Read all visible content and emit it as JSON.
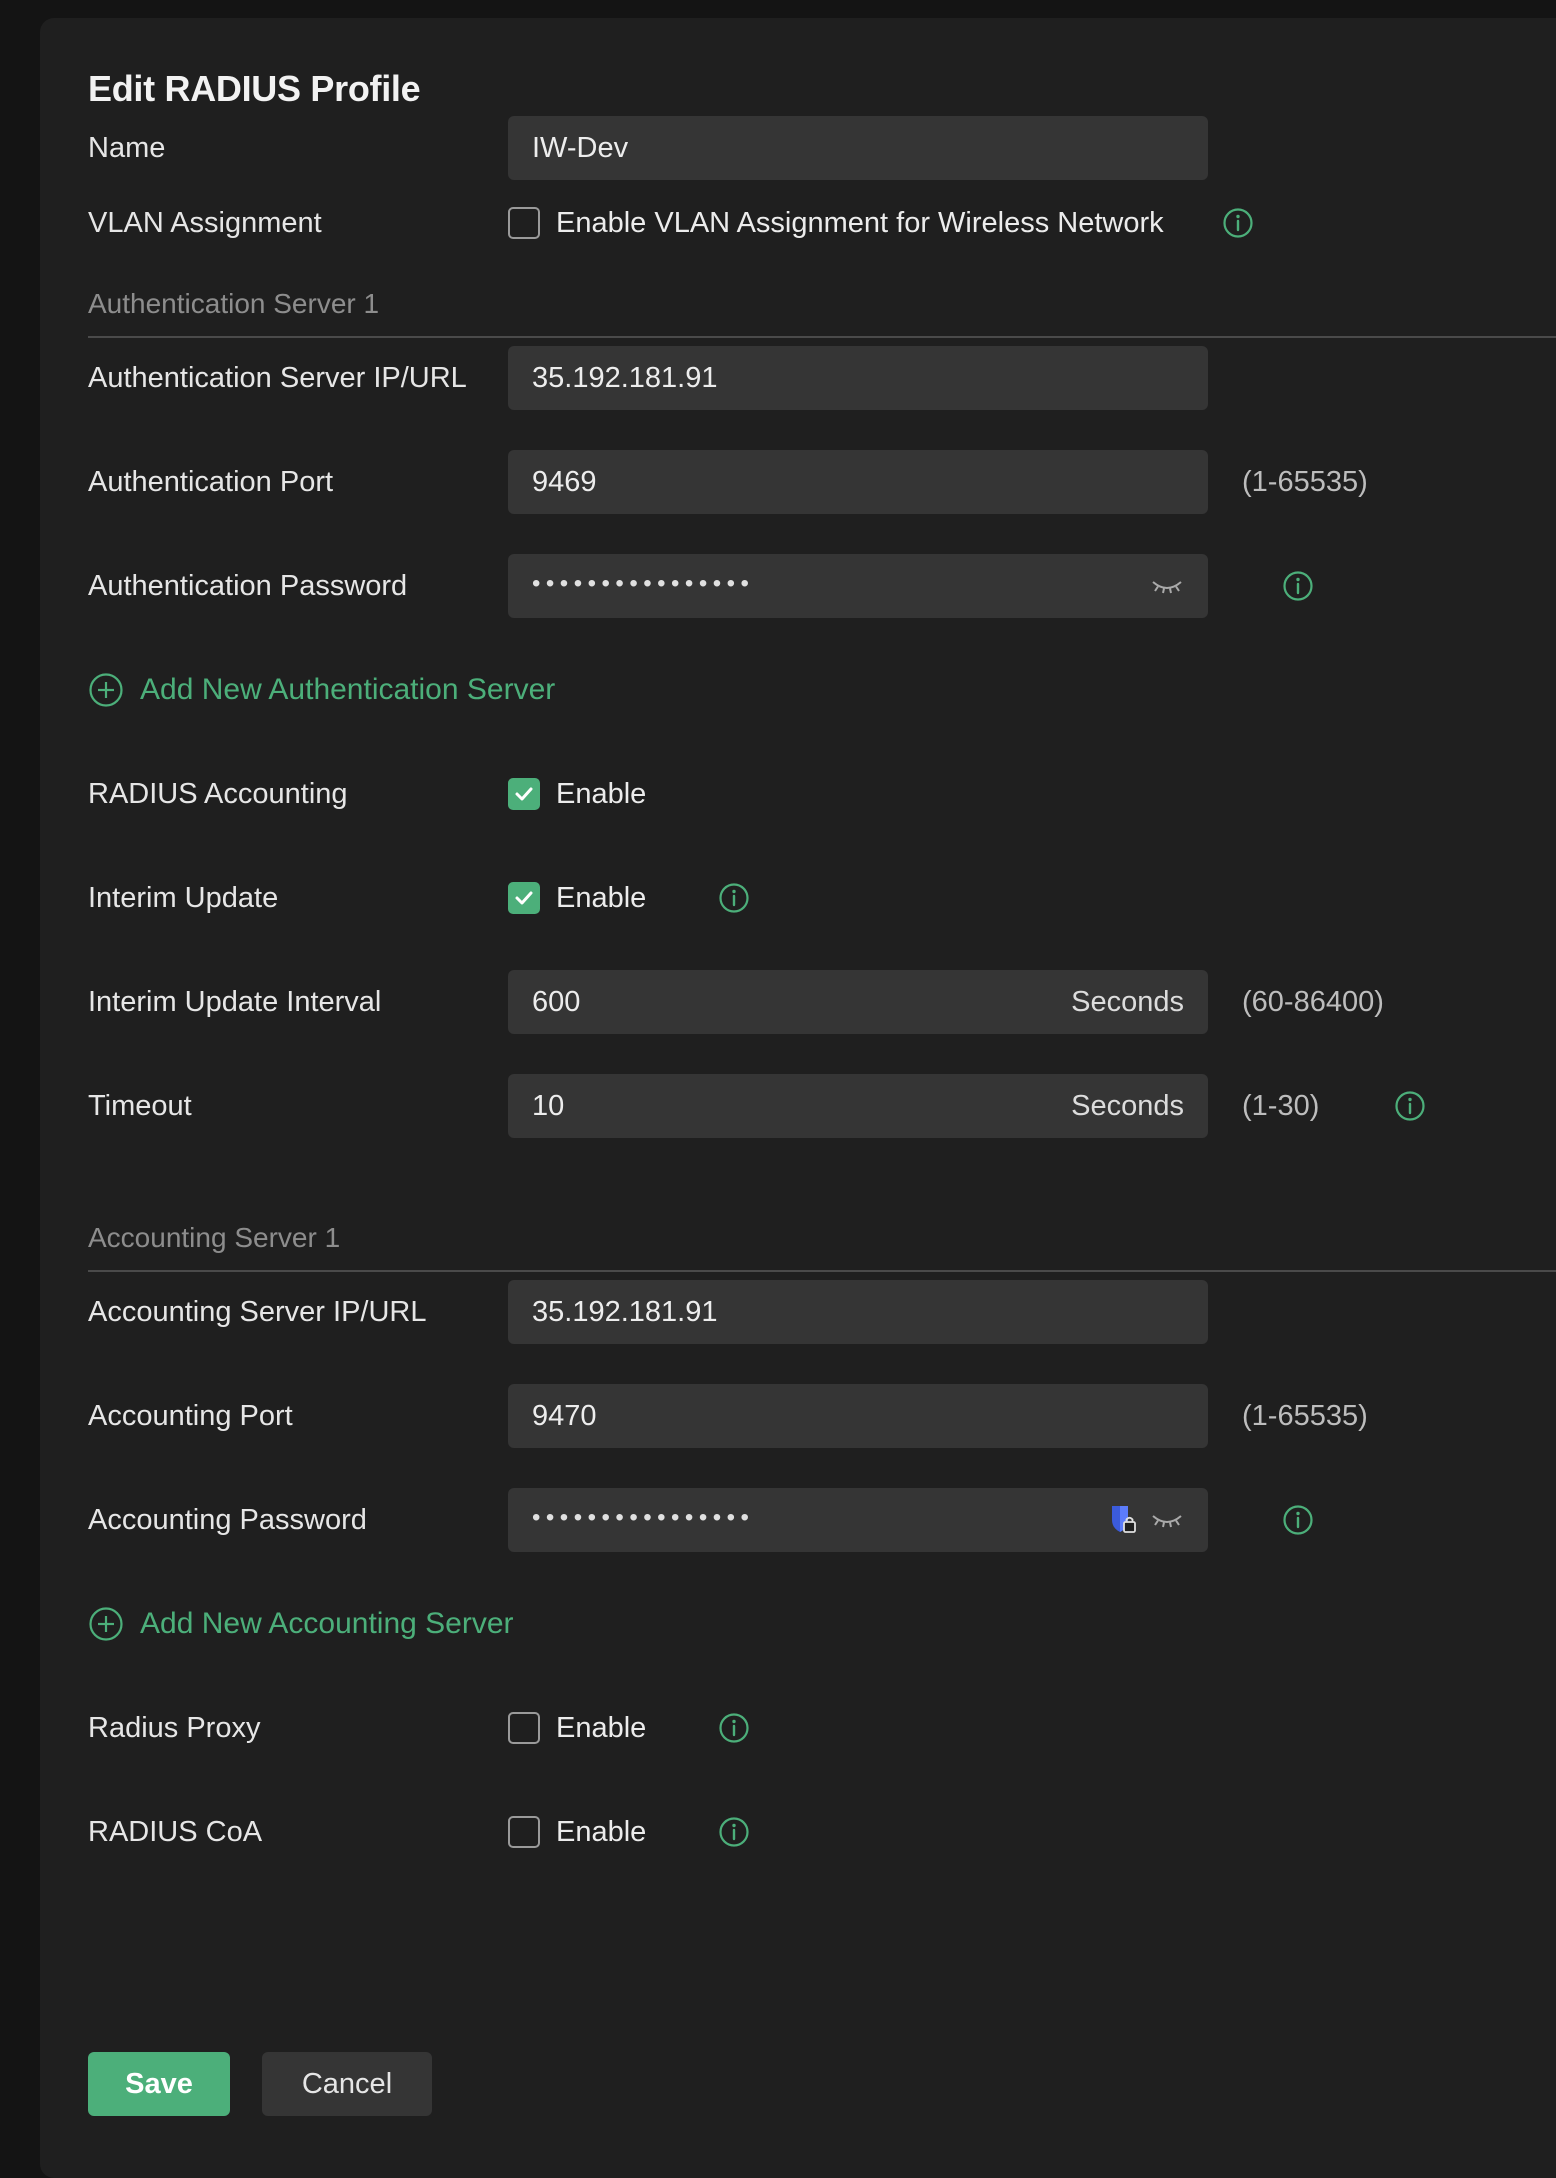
{
  "dialog": {
    "title": "Edit RADIUS Profile"
  },
  "name": {
    "label": "Name",
    "value": "IW-Dev"
  },
  "vlan": {
    "label": "VLAN Assignment",
    "checkbox_label": "Enable VLAN Assignment for Wireless Network",
    "checked": false
  },
  "auth_section": {
    "title": "Authentication Server 1"
  },
  "auth_ip": {
    "label": "Authentication Server IP/URL",
    "value": "35.192.181.91"
  },
  "auth_port": {
    "label": "Authentication Port",
    "value": "9469",
    "range": "(1-65535)"
  },
  "auth_password": {
    "label": "Authentication Password",
    "masked": "••••••••••••••••"
  },
  "add_auth": {
    "label": "Add New Authentication Server"
  },
  "radius_accounting": {
    "label": "RADIUS Accounting",
    "checkbox_label": "Enable",
    "checked": true
  },
  "interim_update": {
    "label": "Interim Update",
    "checkbox_label": "Enable",
    "checked": true
  },
  "interim_interval": {
    "label": "Interim Update Interval",
    "value": "600",
    "unit": "Seconds",
    "range": "(60-86400)"
  },
  "timeout": {
    "label": "Timeout",
    "value": "10",
    "unit": "Seconds",
    "range": "(1-30)"
  },
  "acct_section": {
    "title": "Accounting Server 1"
  },
  "acct_ip": {
    "label": "Accounting Server IP/URL",
    "value": "35.192.181.91"
  },
  "acct_port": {
    "label": "Accounting Port",
    "value": "9470",
    "range": "(1-65535)"
  },
  "acct_password": {
    "label": "Accounting Password",
    "masked": "••••••••••••••••"
  },
  "add_acct": {
    "label": "Add New Accounting Server"
  },
  "radius_proxy": {
    "label": "Radius Proxy",
    "checkbox_label": "Enable",
    "checked": false
  },
  "radius_coa": {
    "label": "RADIUS CoA",
    "checkbox_label": "Enable",
    "checked": false
  },
  "buttons": {
    "save": "Save",
    "cancel": "Cancel"
  },
  "colors": {
    "accent": "#4caf7a",
    "panel": "#1f1f1f",
    "input": "#353535"
  }
}
